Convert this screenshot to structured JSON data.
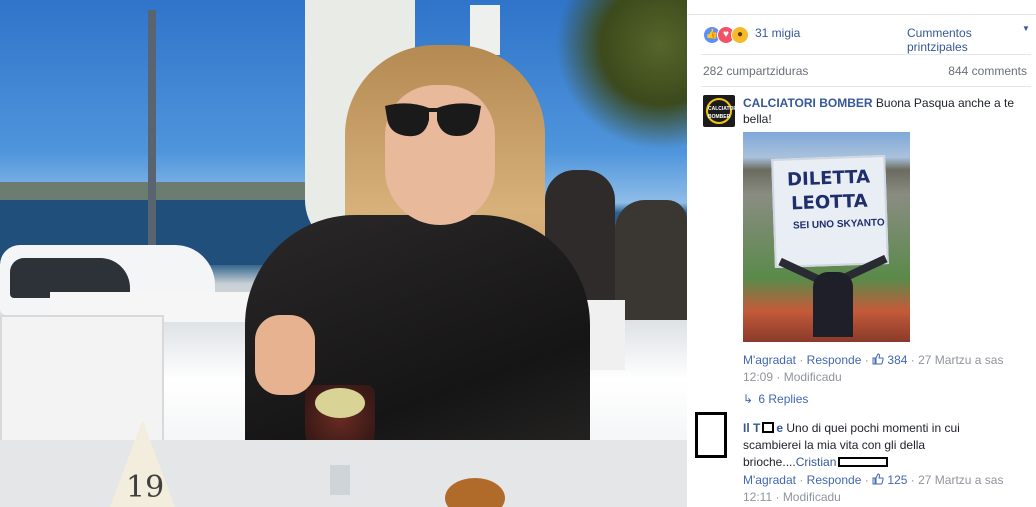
{
  "photo": {
    "table_number": "19"
  },
  "reactions": {
    "count": "31 migia",
    "sort_label": "Cummentos printzipales",
    "colors": {
      "like": "#5890ff",
      "love": "#f25268",
      "wow": "#f7b928"
    }
  },
  "counts": {
    "shares": "282 cumpartziduras",
    "comments": "844 comments"
  },
  "comments": [
    {
      "author": "CALCIATORI BOMBER",
      "avatar_text": "CALCIATORI BOMBER",
      "text": " Buona Pasqua anche a te bella!",
      "image": {
        "banner_text": "DILETTA LEOTTA",
        "banner_sub": "SEI UNO",
        "banner_last": "SKYANTO"
      },
      "like_label": "M'agradat",
      "reply_label": "Responde",
      "likes": "384",
      "timestamp": "27 Martzu a sas 12:09",
      "edited": "Modificadu",
      "replies_label": "6 Replies"
    },
    {
      "author_prefix": "Il T",
      "author_suffix": "e",
      "text": " Uno di quei pochi momenti in cui scambierei la mia vita con gli della brioche....",
      "mention": "Cristian",
      "like_label": "M'agradat",
      "reply_label": "Responde",
      "likes": "125",
      "timestamp": "27 Martzu a sas 12:11",
      "edited": "Modificadu"
    }
  ]
}
